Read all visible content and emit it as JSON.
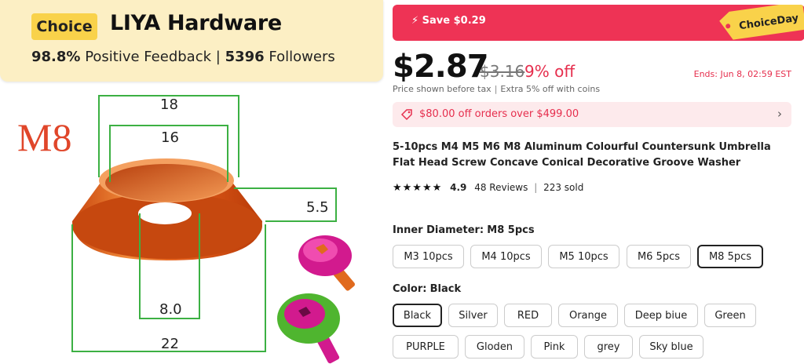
{
  "store": {
    "badge": "Choice",
    "name": "LIYA Hardware",
    "positive_value": "98.8%",
    "positive_label": "Positive Feedback",
    "separator": "|",
    "followers_value": "5396",
    "followers_label": "Followers"
  },
  "image": {
    "size_label": "M8",
    "dim_outer_top": "18",
    "dim_inner_top": "16",
    "dim_height": "5.5",
    "dim_hole": "8.0",
    "dim_outer_bottom": "22",
    "colors": {
      "washer": "#e4601c",
      "dims": "#3cb043",
      "pink_screw": "#d21a8e",
      "green_washer": "#4fb52f"
    }
  },
  "promo": {
    "save_label": "Save $0.29",
    "choiceday_label": "ChoiceDay",
    "price": "$2.87",
    "original_price": "$3.16",
    "discount": "9% off",
    "ends": "Ends: Jun 8, 02:59 EST",
    "tax_note": "Price shown before tax",
    "coins_note": "Extra 5% off with coins",
    "coupon": "$80.00 off orders over $499.00",
    "accent_color": "#ee3355"
  },
  "product": {
    "title": "5-10pcs M4 M5 M6 M8 Aluminum Colourful Countersunk Umbrella Flat Head Screw Concave Conical Decorative Groove Washer",
    "rating": "4.9",
    "reviews": "48 Reviews",
    "sold": "223 sold"
  },
  "options": {
    "diameter_label": "Inner Diameter:",
    "diameter_selected": "M8 5pcs",
    "diameters": [
      "M3 10pcs",
      "M4 10pcs",
      "M5 10pcs",
      "M6 5pcs",
      "M8 5pcs"
    ],
    "color_label": "Color:",
    "color_selected": "Black",
    "colors": [
      "Black",
      "Silver",
      "RED",
      "Orange",
      "Deep biue",
      "Green",
      "PURPLE",
      "Gloden",
      "Pink",
      "grey",
      "Sky blue"
    ]
  }
}
